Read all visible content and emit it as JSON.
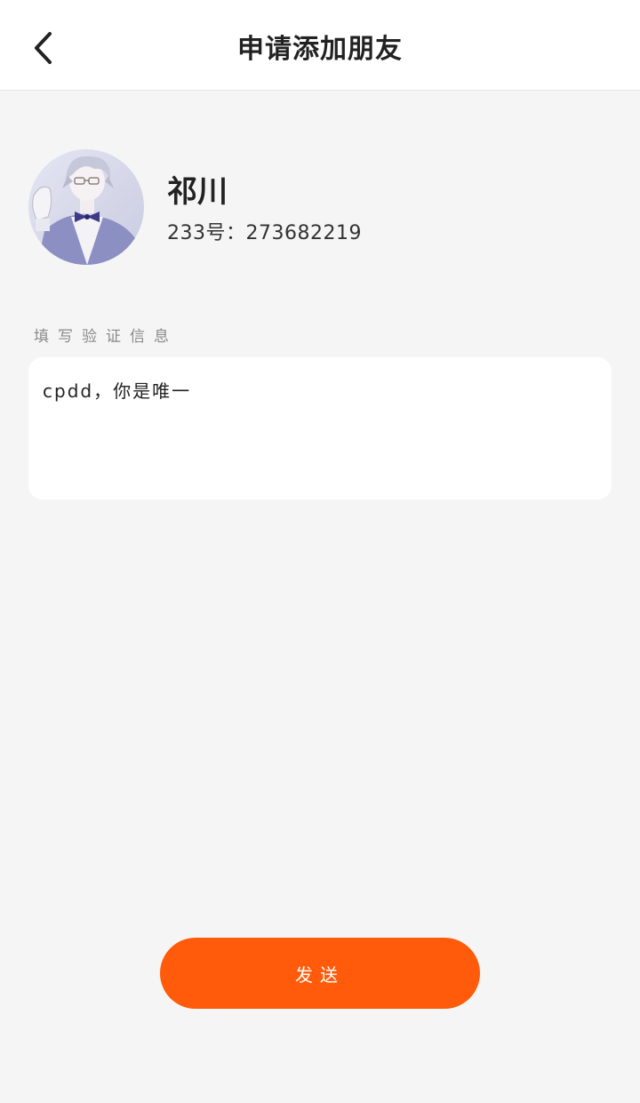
{
  "header": {
    "title": "申请添加朋友",
    "back_icon": "chevron-left-icon"
  },
  "profile": {
    "name": "祁川",
    "id_text": "233号：273682219",
    "avatar_icon": "user-avatar"
  },
  "verification": {
    "label": "填写验证信息",
    "message": "cpdd，你是唯一"
  },
  "actions": {
    "send_label": "发送"
  },
  "colors": {
    "accent": "#ff5b0a",
    "background": "#f4f5f4",
    "card": "#ffffff"
  }
}
